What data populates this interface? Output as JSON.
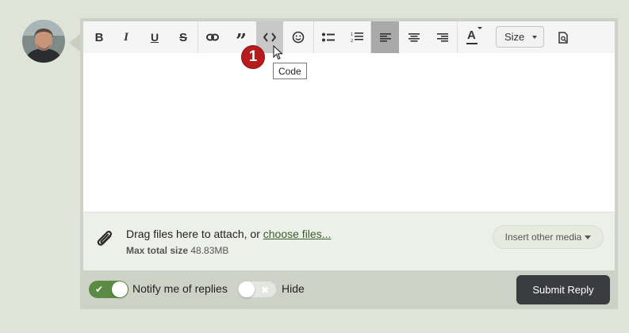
{
  "avatar": {
    "alt": "User avatar"
  },
  "toolbar": {
    "buttons": [
      {
        "name": "bold",
        "glyph": "B"
      },
      {
        "name": "italic",
        "glyph": "I"
      },
      {
        "name": "underline",
        "glyph": "U"
      },
      {
        "name": "strikethrough",
        "glyph": "S"
      },
      {
        "name": "link"
      },
      {
        "name": "quote"
      },
      {
        "name": "code"
      },
      {
        "name": "emoji"
      },
      {
        "name": "bulleted-list"
      },
      {
        "name": "numbered-list"
      },
      {
        "name": "align-left"
      },
      {
        "name": "align-center"
      },
      {
        "name": "align-right"
      },
      {
        "name": "text-color",
        "glyph": "A"
      },
      {
        "name": "preview"
      }
    ],
    "size_label": "Size",
    "active_button": "align-left",
    "hovered_button": "code"
  },
  "annotation": {
    "badge": "1"
  },
  "tooltip": {
    "text": "Code"
  },
  "attachments": {
    "prompt": "Drag files here to attach, or",
    "link": "choose files...",
    "max_label": "Max total size",
    "max_value": "48.83MB",
    "insert_media": "Insert other media"
  },
  "footer": {
    "notify_label": "Notify me of replies",
    "notify_on": true,
    "hide_label": "Hide",
    "hide_on": false,
    "submit_label": "Submit Reply"
  },
  "colors": {
    "accent_green": "#5a8a43",
    "submit_bg": "#3a3c40",
    "badge_red": "#b71c1c",
    "link_green": "#3b5c2c"
  }
}
